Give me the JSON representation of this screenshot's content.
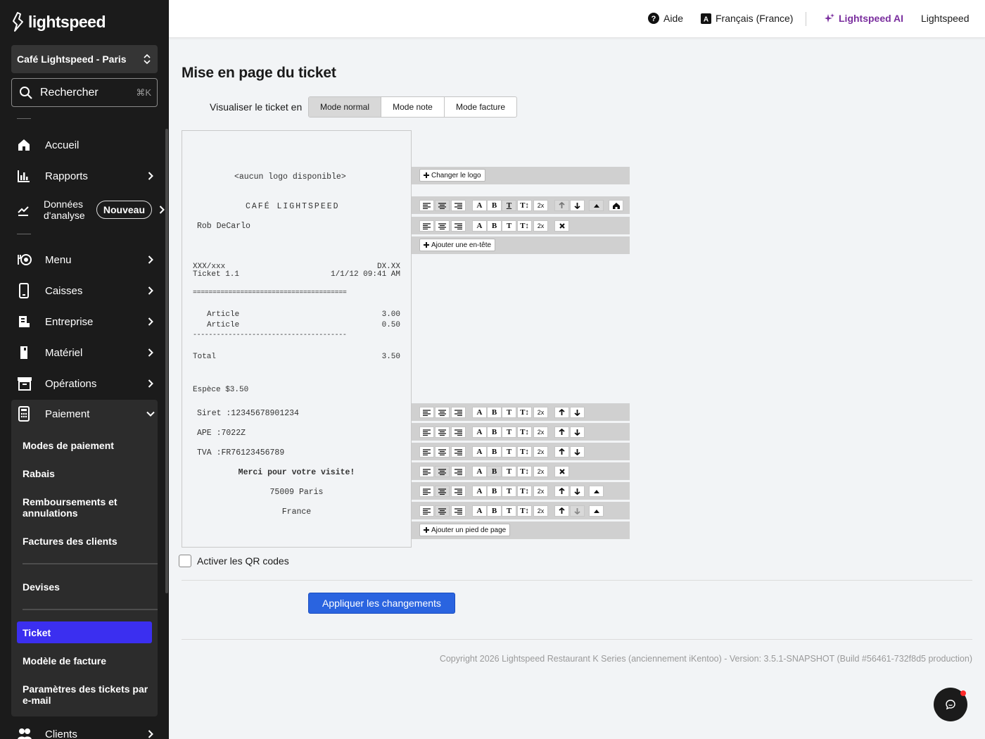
{
  "brand": {
    "logo_text": "lightspeed"
  },
  "sidebar": {
    "location": "Café Lightspeed - Paris",
    "search": {
      "label": "Rechercher",
      "shortcut": "⌘K"
    },
    "items": [
      {
        "label": "Accueil",
        "icon": "home-icon"
      },
      {
        "label": "Rapports",
        "icon": "bar-chart-icon"
      },
      {
        "label": "Données d'analyse",
        "line1": "Données",
        "line2": "d'analyse",
        "badge": "Nouveau",
        "icon": "analytics-icon"
      },
      {
        "label": "Menu",
        "icon": "menu-icon"
      },
      {
        "label": "Caisses",
        "icon": "register-icon"
      },
      {
        "label": "Entreprise",
        "icon": "business-icon"
      },
      {
        "label": "Matériel",
        "icon": "hardware-icon"
      },
      {
        "label": "Opérations",
        "icon": "archive-icon"
      },
      {
        "label": "Paiement",
        "icon": "payment-icon"
      },
      {
        "label": "Clients",
        "icon": "users-icon"
      }
    ],
    "payment_sub": {
      "modes": "Modes de paiement",
      "rabais": "Rabais",
      "remb_1": "Remboursements et",
      "remb_2": "annulations",
      "factures": "Factures des clients",
      "devises": "Devises",
      "ticket": "Ticket",
      "modele": "Modèle de facture",
      "param_1": "Paramètres des tickets par",
      "param_2": "e-mail"
    }
  },
  "topbar": {
    "help": "Aide",
    "language": "Français (France)",
    "ai": "Lightspeed AI",
    "account": "Lightspeed",
    "ai_color": "#7a2e9e"
  },
  "main": {
    "title": "Mise en page du ticket",
    "view_label": "Visualiser le ticket en",
    "modes": [
      "Mode normal",
      "Mode note",
      "Mode facture"
    ],
    "selected_mode": "Mode normal",
    "receipt": {
      "no_logo": "<aucun logo disponible>",
      "shop": "CAFÉ LIGHTSPEED",
      "staff": "Rob DeCarlo",
      "table_left": "XXX/xxx",
      "table_right": "DX.XX",
      "ticket_left": "Ticket 1.1",
      "ticket_right": "1/1/12 09:41 AM",
      "sep_double": "=======================================",
      "items": [
        {
          "name": "Article",
          "price": "3.00"
        },
        {
          "name": "Article",
          "price": "0.50"
        }
      ],
      "sep_single": "---------------------------------------",
      "total_label": "Total",
      "total_value": "3.50",
      "payment": "Espèce $3.50",
      "siret": "Siret :12345678901234",
      "ape": "APE :7022Z",
      "tva": "TVA :FR76123456789",
      "thanks": "Merci pour votre visite!",
      "city": "75009 Paris",
      "country": "France"
    },
    "buttons": {
      "change_logo": "Changer le logo",
      "add_header": "Ajouter une en-tête",
      "add_footer": "Ajouter un pied de page"
    },
    "format": {
      "A": "A",
      "B": "B",
      "T": "T",
      "Tsize": "T↕",
      "x2": "2x"
    },
    "qr_label": "Activer les QR codes",
    "apply": "Appliquer les changements",
    "copyright": "Copyright 2026 Lightspeed Restaurant K Series (anciennement iKentoo) - Version: 3.5.1-SNAPSHOT (Build #56461-732f8d5 production)"
  },
  "colors": {
    "accent": "#3b2ff0",
    "apply_button": "#2a64e0",
    "sidebar": "#1b1b1b",
    "notification": "#ff2a2a"
  }
}
